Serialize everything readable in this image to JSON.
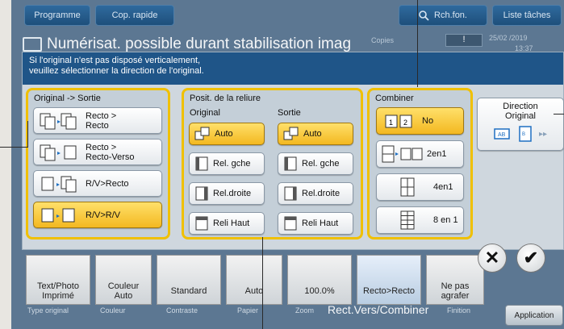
{
  "topbar": {
    "programme": "Programme",
    "copy_quick": "Cop. rapide",
    "search": "Rch.fon.",
    "jobs": "Liste tâches"
  },
  "status": {
    "title": "Numérisat. possible durant stabilisation imag",
    "copies_label": "Copies",
    "date": "25/02 /2019",
    "time": "13:37"
  },
  "dialog": {
    "message_line1": "Si l'original n'est pas disposé verticalement,",
    "message_line2": "veuillez sélectionner la direction de l'original.",
    "original_sortie": {
      "label": "Original -> Sortie",
      "options": [
        "Recto > Recto",
        "Recto > Recto-Verso",
        "R/V>Recto",
        "R/V>R/V"
      ],
      "selected": "R/V>R/V"
    },
    "binding": {
      "label": "Posit. de la reliure",
      "original_label": "Original",
      "sortie_label": "Sortie",
      "original_options": [
        "Auto",
        "Rel. gche",
        "Rel.droite",
        "Reli Haut"
      ],
      "sortie_options": [
        "Auto",
        "Rel. gche",
        "Rel.droite",
        "Reli Haut"
      ],
      "selected": "Auto"
    },
    "combine": {
      "label": "Combiner",
      "options": [
        "No",
        "2en1",
        "4en1",
        "8 en 1"
      ],
      "selected": "No"
    },
    "direction": {
      "label_line1": "Direction",
      "label_line2": "Original"
    }
  },
  "bottom": {
    "items": [
      {
        "label1": "Text/Photo",
        "label2": "Imprimé",
        "caption": "Type original"
      },
      {
        "label1": "Couleur",
        "label2": "Auto",
        "caption": "Couleur"
      },
      {
        "label1": "Standard",
        "label2": "",
        "caption": "Contraste"
      },
      {
        "label1": "Auto",
        "label2": "",
        "caption": "Papier"
      },
      {
        "label1": "100.0%",
        "label2": "",
        "caption": "Zoom"
      },
      {
        "label1": "Recto>Recto",
        "label2": "",
        "caption": "Rect.Vers/Combiner"
      },
      {
        "label1": "Ne pas",
        "label2": "agrafer",
        "caption": "Finition"
      }
    ],
    "application": "Application"
  },
  "colors": {
    "highlight": "#f0c000",
    "selected_button": "#f7c530",
    "banner": "#1f5588"
  }
}
